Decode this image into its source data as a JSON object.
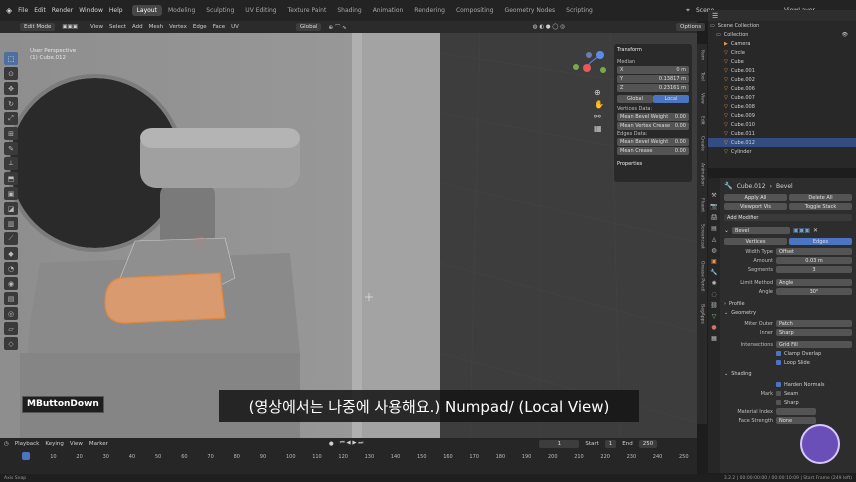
{
  "topbar": {
    "menus": [
      "File",
      "Edit",
      "Render",
      "Window",
      "Help"
    ],
    "workspaces": [
      "Layout",
      "Modeling",
      "Sculpting",
      "UV Editing",
      "Texture Paint",
      "Shading",
      "Animation",
      "Rendering",
      "Compositing",
      "Geometry Nodes",
      "Scripting"
    ],
    "active_workspace": "Layout",
    "scene_label": "Scene",
    "viewlayer_label": "ViewLayer"
  },
  "viewport_header": {
    "mode": "Edit Mode",
    "menus": [
      "View",
      "Select",
      "Add",
      "Mesh",
      "Vertex",
      "Edge",
      "Face",
      "UV"
    ],
    "orientation": "Global",
    "options": "Options"
  },
  "viewport": {
    "perspective": "User Perspective",
    "object": "(1) Cube.012"
  },
  "npanel": {
    "section": "Transform",
    "median": "Median",
    "x_label": "X",
    "x_val": "0 m",
    "y_label": "Y",
    "y_val": "0.13817 m",
    "z_label": "Z",
    "z_val": "0.23161 m",
    "global": "Global",
    "local": "Local",
    "verts_data": "Vertices Data:",
    "mean_bevel_weight": "Mean Bevel Weight",
    "mbw_val": "0.00",
    "mean_vertex_crease": "Mean Vertex Crease",
    "mvc_val": "0.00",
    "edges_data": "Edges Data:",
    "mean_bevel_weight2": "Mean Bevel Weight",
    "mbw2_val": "0.00",
    "mean_crease": "Mean Crease",
    "mc_val": "0.00",
    "properties": "Properties"
  },
  "sidetabs": [
    "Item",
    "Tool",
    "View",
    "Edit",
    "Create",
    "Animation",
    "Fluent",
    "Screencast",
    "Grease Pencil",
    "BagApps"
  ],
  "outliner": {
    "scene_collection": "Scene Collection",
    "items": [
      "Collection",
      "Camera",
      "Circle",
      "Cube",
      "Cube.001",
      "Cube.002",
      "Cube.006",
      "Cube.007",
      "Cube.008",
      "Cube.009",
      "Cube.010",
      "Cube.011",
      "Cube.012",
      "Cylinder"
    ],
    "selected": "Cube.012"
  },
  "properties": {
    "object_name": "Cube.012",
    "modifier_name": "Bevel",
    "apply_all": "Apply All",
    "delete_all": "Delete All",
    "viewport_vis": "Viewport Vis",
    "toggle_stack": "Toggle Stack",
    "add_modifier": "Add Modifier",
    "bevel": "Bevel",
    "vertices": "Vertices",
    "edges": "Edges",
    "width_type_label": "Width Type",
    "width_type": "Offset",
    "amount_label": "Amount",
    "amount": "0.03 m",
    "segments_label": "Segments",
    "segments": "3",
    "limit_method_label": "Limit Method",
    "limit_method": "Angle",
    "angle_label": "Angle",
    "angle": "30°",
    "profile": "Profile",
    "geometry": "Geometry",
    "miter_outer_label": "Miter Outer",
    "miter_outer": "Patch",
    "inner_label": "Inner",
    "inner": "Sharp",
    "intersections_label": "Intersections",
    "intersections": "Grid Fill",
    "clamp_overlap": "Clamp Overlap",
    "loop_slide": "Loop Slide",
    "shading": "Shading",
    "harden_normals": "Harden Normals",
    "mark_label": "Mark",
    "seam": "Seam",
    "sharp": "Sharp",
    "material_index_label": "Material Index",
    "face_strength_label": "Face Strength",
    "face_strength": "None"
  },
  "timeline": {
    "menus": [
      "Playback",
      "Keying",
      "View",
      "Marker"
    ],
    "current_frame": "1",
    "start_label": "Start",
    "start": "1",
    "end_label": "End",
    "end": "250",
    "ticks": [
      "1",
      "10",
      "20",
      "30",
      "40",
      "50",
      "60",
      "70",
      "80",
      "90",
      "100",
      "110",
      "120",
      "130",
      "140",
      "150",
      "160",
      "170",
      "180",
      "190",
      "200",
      "210",
      "220",
      "230",
      "240",
      "250"
    ]
  },
  "status": {
    "left": "Axis Snap",
    "right": "3.2.2 | 00:00:00:00 / 00:00:10:09 | Start Frame (249 left)"
  },
  "overlay": {
    "mbutton": "MButtonDown",
    "subtitle": "(영상에서는 나중에 사용해요.) Numpad/ (Local View)"
  }
}
